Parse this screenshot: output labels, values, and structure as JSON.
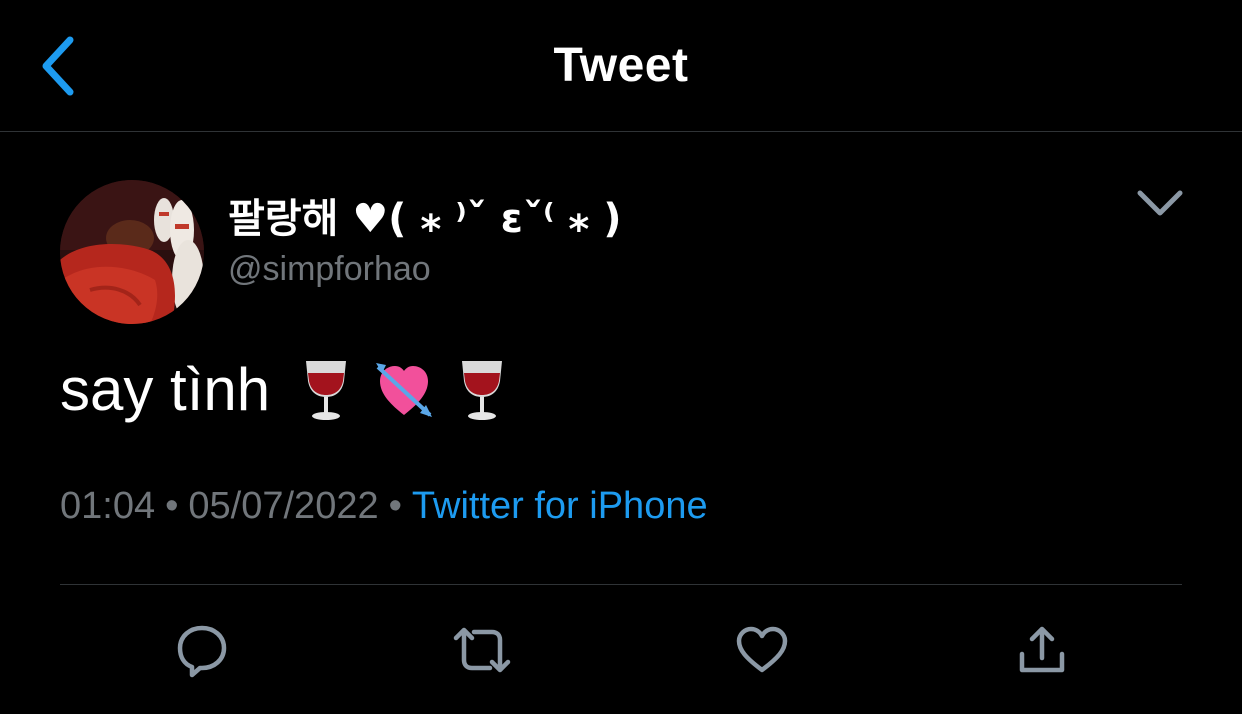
{
  "header": {
    "title": "Tweet",
    "back_icon": "chevron-left-icon"
  },
  "tweet": {
    "author": {
      "display_name": "팔랑해 ♥( ⁎ ⁾ˇ εˇ⁽ ⁎ )",
      "handle": "@simpforhao",
      "avatar_icon": "avatar-image"
    },
    "text": "say tình",
    "emojis": [
      "wine-glass-emoji",
      "heart-with-arrow-emoji",
      "wine-glass-emoji"
    ],
    "time": "01:04",
    "date": "05/07/2022",
    "separator": "•",
    "source": "Twitter for iPhone"
  },
  "actions": [
    "reply-icon",
    "retweet-icon",
    "like-icon",
    "share-icon"
  ],
  "colors": {
    "background": "#000000",
    "text": "#ffffff",
    "secondary": "#71767b",
    "accent": "#1d9bf0",
    "divider": "#2f3336",
    "icon": "#8b98a5"
  }
}
